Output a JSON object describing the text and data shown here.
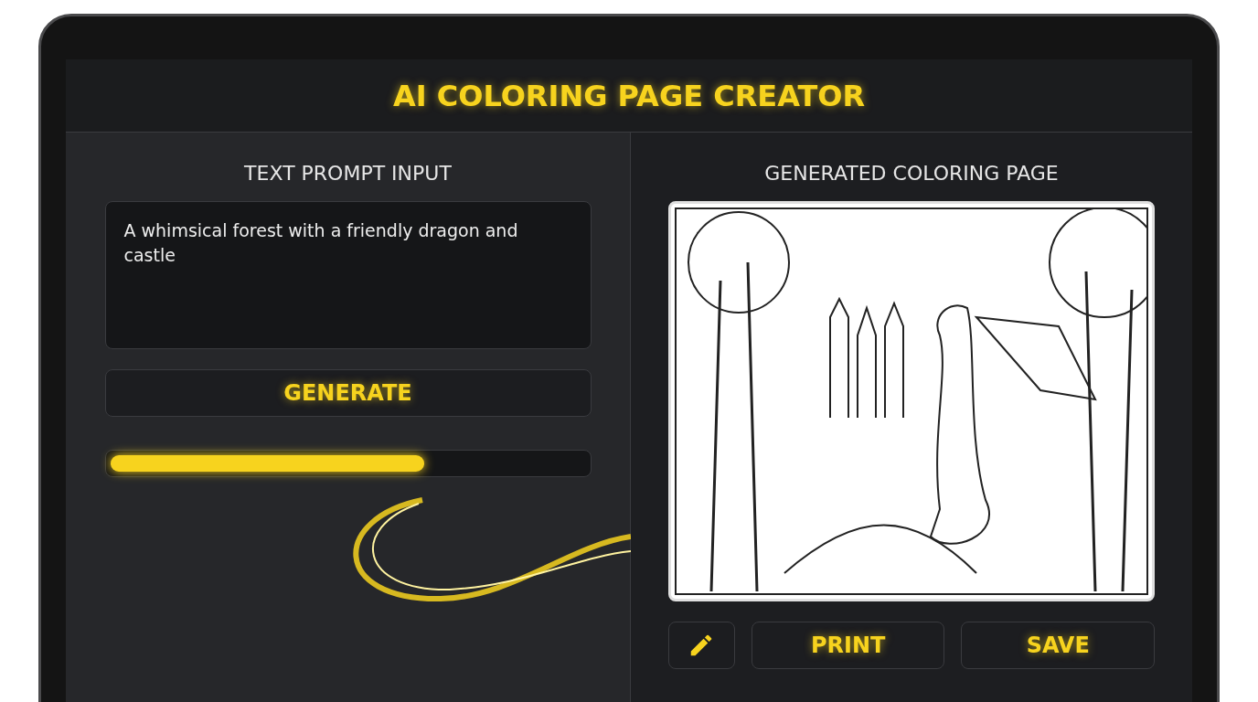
{
  "header": {
    "title": "AI COLORING PAGE CREATOR"
  },
  "prompt_panel": {
    "title": "TEXT PROMPT INPUT",
    "prompt_value": "A whimsical forest with a friendly dragon and castle",
    "generate_button": "GENERATE",
    "progress": {
      "level": 0.66
    }
  },
  "output_panel": {
    "title": "GENERATED COLORING PAGE",
    "actions": [
      {
        "kind": "edit"
      },
      {
        "kind": "text",
        "label": "PRINT"
      },
      {
        "kind": "text",
        "label": "SAVE"
      }
    ]
  }
}
